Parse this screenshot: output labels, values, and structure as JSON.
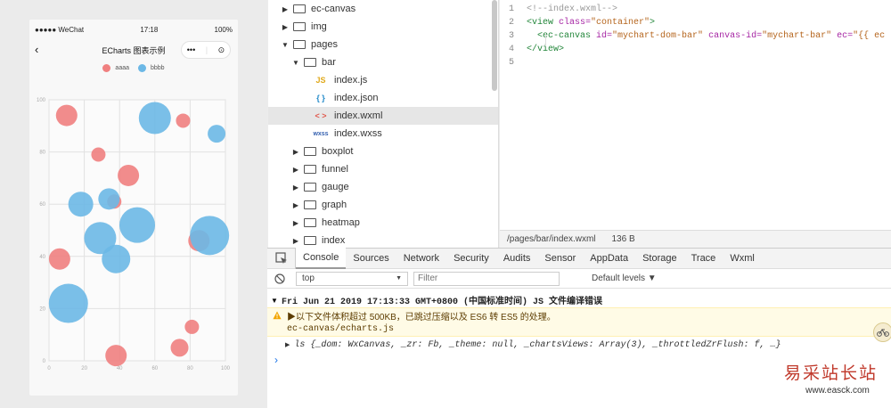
{
  "phone": {
    "carrier": "●●●●● WeChat",
    "time": "17:18",
    "battery": "100%",
    "title": "ECharts 图表示例",
    "capsule_more": "•••",
    "capsule_close": "⊙"
  },
  "chart_data": {
    "type": "scatter",
    "title": "",
    "xlabel": "",
    "ylabel": "",
    "xlim": [
      0,
      100
    ],
    "ylim": [
      0,
      100
    ],
    "x_ticks": [
      "0",
      "20",
      "40",
      "60",
      "80",
      "100"
    ],
    "y_ticks": [
      "0",
      "20",
      "40",
      "60",
      "80",
      "100"
    ],
    "grid": true,
    "legend": "top",
    "series": [
      {
        "name": "aaaa",
        "color": "#f08080",
        "points": [
          {
            "x": 10,
            "y": 94,
            "size": 6
          },
          {
            "x": 28,
            "y": 79,
            "size": 4
          },
          {
            "x": 45,
            "y": 71,
            "size": 6
          },
          {
            "x": 37,
            "y": 61,
            "size": 4
          },
          {
            "x": 85,
            "y": 46,
            "size": 6
          },
          {
            "x": 6,
            "y": 39,
            "size": 6
          },
          {
            "x": 81,
            "y": 13,
            "size": 4
          },
          {
            "x": 74,
            "y": 5,
            "size": 5
          },
          {
            "x": 38,
            "y": 2,
            "size": 6
          },
          {
            "x": 76,
            "y": 92,
            "size": 4
          }
        ]
      },
      {
        "name": "bbbb",
        "color": "#6cb8e6",
        "points": [
          {
            "x": 60,
            "y": 93,
            "size": 9
          },
          {
            "x": 95,
            "y": 87,
            "size": 5
          },
          {
            "x": 18,
            "y": 60,
            "size": 7
          },
          {
            "x": 34,
            "y": 62,
            "size": 6
          },
          {
            "x": 50,
            "y": 52,
            "size": 10
          },
          {
            "x": 29,
            "y": 47,
            "size": 9
          },
          {
            "x": 38,
            "y": 39,
            "size": 8
          },
          {
            "x": 91,
            "y": 48,
            "size": 11
          },
          {
            "x": 11,
            "y": 22,
            "size": 11
          }
        ]
      }
    ]
  },
  "file_tree": [
    {
      "indent": 0,
      "caret": "▶",
      "type": "folder",
      "name": "ec-canvas"
    },
    {
      "indent": 0,
      "caret": "▶",
      "type": "folder",
      "name": "img"
    },
    {
      "indent": 0,
      "caret": "▼",
      "type": "folder",
      "name": "pages"
    },
    {
      "indent": 1,
      "caret": "▼",
      "type": "folder",
      "name": "bar"
    },
    {
      "indent": 2,
      "caret": "",
      "type": "js",
      "icon": "JS",
      "name": "index.js"
    },
    {
      "indent": 2,
      "caret": "",
      "type": "json",
      "icon": "{ }",
      "name": "index.json"
    },
    {
      "indent": 2,
      "caret": "",
      "type": "wxml",
      "icon": "< >",
      "name": "index.wxml",
      "selected": true
    },
    {
      "indent": 2,
      "caret": "",
      "type": "wxss",
      "icon": "wxss",
      "name": "index.wxss"
    },
    {
      "indent": 1,
      "caret": "▶",
      "type": "folder",
      "name": "boxplot"
    },
    {
      "indent": 1,
      "caret": "▶",
      "type": "folder",
      "name": "funnel"
    },
    {
      "indent": 1,
      "caret": "▶",
      "type": "folder",
      "name": "gauge"
    },
    {
      "indent": 1,
      "caret": "▶",
      "type": "folder",
      "name": "graph"
    },
    {
      "indent": 1,
      "caret": "▶",
      "type": "folder",
      "name": "heatmap"
    },
    {
      "indent": 1,
      "caret": "▶",
      "type": "folder",
      "name": "index"
    }
  ],
  "editor": {
    "lines": [
      {
        "num": "1",
        "parts": [
          {
            "t": "<!--index.wxml-->",
            "c": "#999999"
          }
        ]
      },
      {
        "num": "2",
        "parts": [
          {
            "t": "<view ",
            "c": "#22863a"
          },
          {
            "t": "class=",
            "c": "#a626a4"
          },
          {
            "t": "\"container\"",
            "c": "#b5651d"
          },
          {
            "t": ">",
            "c": "#22863a"
          }
        ]
      },
      {
        "num": "3",
        "parts": [
          {
            "t": "  <ec-canvas ",
            "c": "#22863a"
          },
          {
            "t": "id=",
            "c": "#a626a4"
          },
          {
            "t": "\"mychart-dom-bar\" ",
            "c": "#b5651d"
          },
          {
            "t": "canvas-id=",
            "c": "#a626a4"
          },
          {
            "t": "\"mychart-bar\" ",
            "c": "#b5651d"
          },
          {
            "t": "ec=",
            "c": "#a626a4"
          },
          {
            "t": "\"{{ ec",
            "c": "#b5651d"
          }
        ]
      },
      {
        "num": "4",
        "parts": [
          {
            "t": "</view>",
            "c": "#22863a"
          }
        ]
      },
      {
        "num": "5",
        "parts": []
      }
    ],
    "status_path": "/pages/bar/index.wxml",
    "status_size": "136 B"
  },
  "devtools": {
    "tabs": [
      "Console",
      "Sources",
      "Network",
      "Security",
      "Audits",
      "Sensor",
      "AppData",
      "Storage",
      "Trace",
      "Wxml"
    ],
    "active_tab": "Console",
    "context": "top",
    "filter_placeholder": "Filter",
    "levels": "Default levels ▼"
  },
  "console": {
    "group_header": "Fri Jun 21 2019 17:13:33 GMT+0800 (中国标准时间) JS 文件编译错误",
    "warning": "▶以下文件体积超过 500KB，已跳过压缩以及 ES6 转 ES5 的处理。",
    "warning_file": "ec-canvas/echarts.js",
    "log": "ls {_dom: WxCanvas, _zr: Fb, _theme: null, _chartsViews: Array(3), _throttledZrFlush: f, …}",
    "prompt": "›"
  },
  "watermark": {
    "cn": "易采站长站",
    "url": "www.easck.com"
  }
}
